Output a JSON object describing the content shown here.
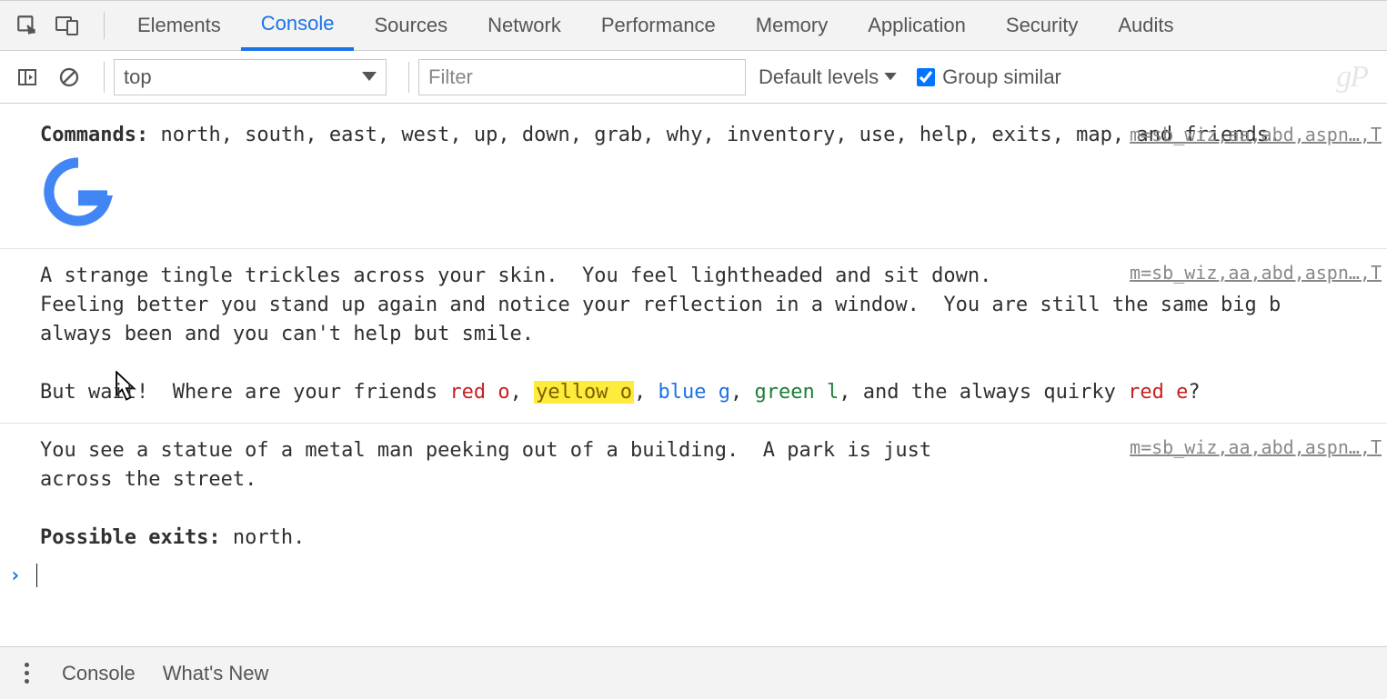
{
  "tabs": {
    "items": [
      "Elements",
      "Console",
      "Sources",
      "Network",
      "Performance",
      "Memory",
      "Application",
      "Security",
      "Audits"
    ],
    "activeIndex": 1
  },
  "toolbar": {
    "context": "top",
    "filter_placeholder": "Filter",
    "levels_label": "Default levels",
    "group_label": "Group similar",
    "group_checked": true,
    "watermark": "gP"
  },
  "entries": [
    {
      "type": "commands",
      "label": "Commands:",
      "list": " north, south, east, west, up, down, grab, why, inventory, use, help, exits, map, and friends.",
      "source": "m=sb_wiz,aa,abd,aspn…,T"
    },
    {
      "type": "logo"
    },
    {
      "type": "story",
      "source": "m=sb_wiz,aa,abd,aspn…,T",
      "line1": "A strange tingle trickles across your skin.  You feel lightheaded and sit down.",
      "line2": "Feeling better you stand up again and notice your reflection in a window.  You are still the same big b",
      "line3": "always been and you can't help but smile.",
      "line4_pre": "But wait!  Where are your friends ",
      "friends": {
        "red_o": "red o",
        "yellow_o": "yellow o",
        "blue_g": "blue g",
        "green_l": "green l",
        "red_e": "red e"
      },
      "line4_join1": ", ",
      "line4_join2": ", ",
      "line4_join3": ", ",
      "line4_join4": ", and the always quirky ",
      "line4_end": "?"
    },
    {
      "type": "scene",
      "source": "m=sb_wiz,aa,abd,aspn…,T",
      "line1": "You see a statue of a metal man peeking out of a building.  A park is just",
      "line2": "across the street.",
      "exits_label": "Possible exits:",
      "exits_val": " north."
    }
  ],
  "prompt_glyph": "›",
  "drawer": {
    "tabs": [
      "Console",
      "What's New"
    ]
  }
}
